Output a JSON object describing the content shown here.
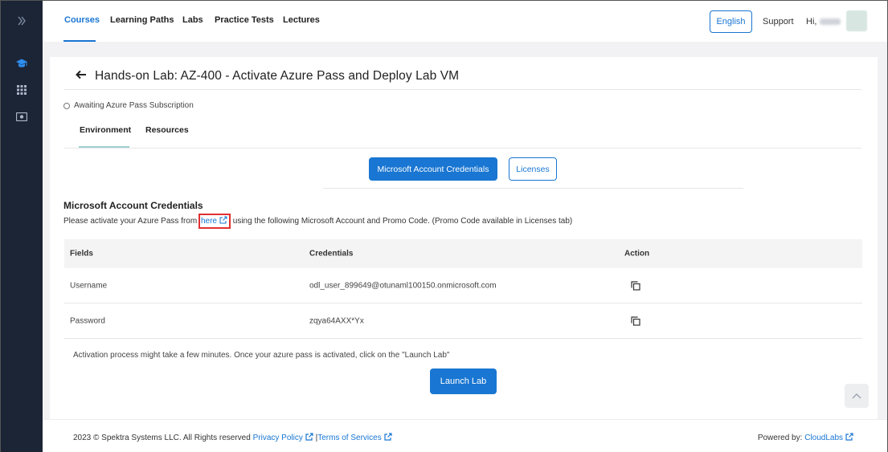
{
  "nav": {
    "tabs": [
      "Courses",
      "Learning Paths",
      "Labs",
      "Practice Tests",
      "Lectures"
    ],
    "language": "English",
    "support": "Support",
    "greeting": "Hi,"
  },
  "sidebar": {
    "icons": [
      "chevron-right-icon",
      "graduation-cap-icon",
      "grid-icon",
      "money-icon"
    ]
  },
  "page": {
    "title": "Hands-on Lab: AZ-400 - Activate Azure Pass and Deploy Lab VM",
    "status": "Awaiting Azure Pass Subscription",
    "tabs": [
      "Environment",
      "Resources"
    ],
    "buttons": {
      "credentials": "Microsoft Account Credentials",
      "licenses": "Licenses"
    },
    "section_title": "Microsoft Account Credentials",
    "desc_before": "Please activate your Azure Pass from ",
    "desc_link": "here",
    "desc_after": " using the following Microsoft Account and Promo Code. (Promo Code available in Licenses tab)",
    "table": {
      "headers": [
        "Fields",
        "Credentials",
        "Action"
      ],
      "rows": [
        [
          "Username",
          "odl_user_899649@otunaml100150.onmicrosoft.com"
        ],
        [
          "Password",
          "zqya64AXX*Yx"
        ]
      ]
    },
    "note": "Activation process might take a few minutes. Once your azure pass is activated, click on the \"Launch Lab\"",
    "launch": "Launch Lab"
  },
  "footer": {
    "copyright": "2023 © Spektra Systems LLC. All Rights reserved",
    "privacy": "Privacy Policy",
    "separator": "|",
    "terms": "Terms of Services",
    "powered": "Powered by:",
    "cloudlabs": "CloudLabs"
  },
  "colors": {
    "accent": "#1976d2",
    "sidebar": "#1c2536",
    "highlight_box": "#e03030"
  }
}
